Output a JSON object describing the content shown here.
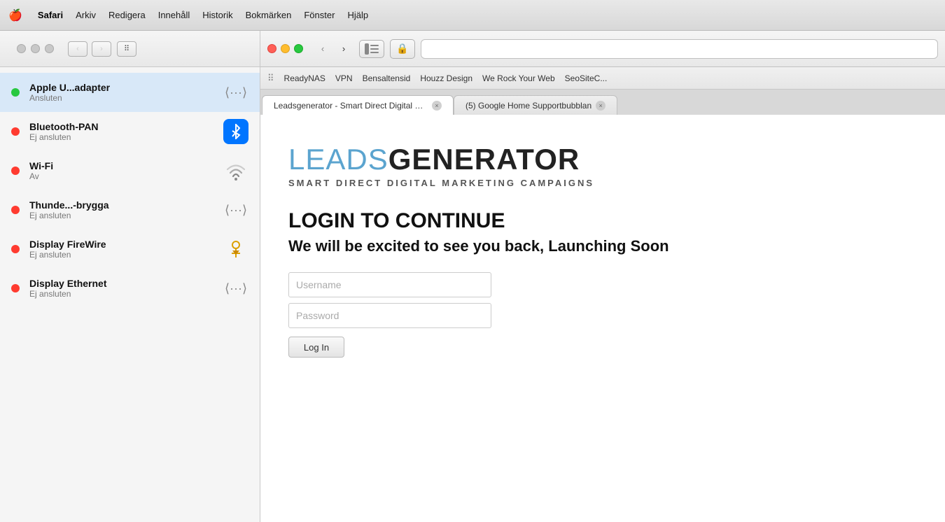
{
  "menubar": {
    "apple": "🍎",
    "app_name": "Safari",
    "items": [
      "Arkiv",
      "Redigera",
      "Innehåll",
      "Historik",
      "Bokmärken",
      "Fönster",
      "Hjälp"
    ]
  },
  "safari": {
    "bookmarks": [
      {
        "label": "ReadyNAS"
      },
      {
        "label": "VPN"
      },
      {
        "label": "Bensaltensid"
      },
      {
        "label": "Houzz Design"
      },
      {
        "label": "We Rock Your Web"
      },
      {
        "label": "SeoSiteC..."
      }
    ],
    "tabs": [
      {
        "label": "Leadsgenerator - Smart Direct Digital M...",
        "active": true
      },
      {
        "label": "(5) Google Home Supportbubblan",
        "active": false
      }
    ]
  },
  "network_panel": {
    "items": [
      {
        "name": "Apple U...adapter",
        "status": "Ansluten",
        "dot": "green",
        "icon_type": "dots"
      },
      {
        "name": "Bluetooth-PAN",
        "status": "Ej ansluten",
        "dot": "red",
        "icon_type": "bluetooth"
      },
      {
        "name": "Wi-Fi",
        "status": "Av",
        "dot": "red",
        "icon_type": "wifi"
      },
      {
        "name": "Thunde...-brygga",
        "status": "Ej ansluten",
        "dot": "red",
        "icon_type": "dots"
      },
      {
        "name": "Display FireWire",
        "status": "Ej ansluten",
        "dot": "red",
        "icon_type": "firewire"
      },
      {
        "name": "Display Ethernet",
        "status": "Ej ansluten",
        "dot": "red",
        "icon_type": "dots"
      }
    ]
  },
  "brand": {
    "leads": "LEADS",
    "generator": "GENERATOR",
    "tagline": "SMART DIRECT DIGITAL MARKETING CAMPAIGNS"
  },
  "login": {
    "heading": "LOGIN TO CONTINUE",
    "subtext": "We will be excited to see you back, Launching Soon",
    "username_placeholder": "Username",
    "password_placeholder": "Password",
    "button_label": "Log In"
  }
}
